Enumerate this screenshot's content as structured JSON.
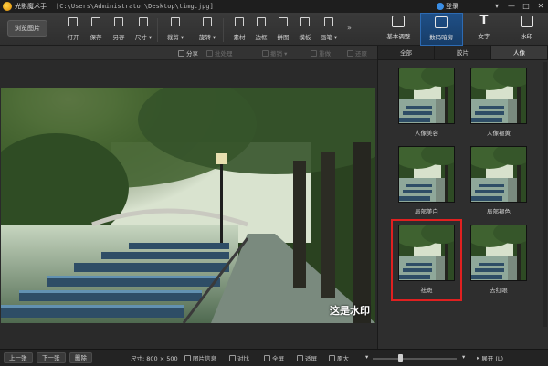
{
  "window": {
    "app_name": "光影魔术手",
    "file_path": "[C:\\Users\\Administrator\\Desktop\\timg.jpg]",
    "login_label": "登录",
    "controls": [
      "▾",
      "—",
      "□",
      "✕"
    ]
  },
  "toolbar": {
    "browse_label": "浏览图片",
    "tools": [
      {
        "label": "打开",
        "icon": "open-icon"
      },
      {
        "label": "保存",
        "icon": "save-icon"
      },
      {
        "label": "另存",
        "icon": "save-as-icon"
      },
      {
        "label": "尺寸 ▾",
        "icon": "resize-icon"
      },
      {
        "label": "裁剪 ▾",
        "icon": "crop-icon"
      },
      {
        "label": "旋转 ▾",
        "icon": "rotate-icon"
      },
      {
        "label": "素材",
        "icon": "material-icon"
      },
      {
        "label": "边框",
        "icon": "border-icon"
      },
      {
        "label": "拼图",
        "icon": "collage-icon"
      },
      {
        "label": "模板",
        "icon": "template-icon"
      },
      {
        "label": "画笔 ▾",
        "icon": "brush-icon"
      }
    ],
    "more": "»"
  },
  "right_tabs": [
    {
      "label": "基本调整",
      "icon": "adjust-icon",
      "active": false
    },
    {
      "label": "数码暗房",
      "icon": "camera-icon",
      "active": true
    },
    {
      "label": "文字",
      "icon": "text-icon",
      "active": false
    },
    {
      "label": "水印",
      "icon": "watermark-icon",
      "active": false
    }
  ],
  "subbar": {
    "items": [
      {
        "label": "分享",
        "icon": "share-icon",
        "enabled": true
      },
      {
        "label": "批处理",
        "icon": "batch-icon",
        "enabled": false
      },
      {
        "label": "撤销 ▾",
        "icon": "undo-icon",
        "enabled": false
      },
      {
        "label": "重做",
        "icon": "redo-icon",
        "enabled": false
      },
      {
        "label": "还原",
        "icon": "restore-icon",
        "enabled": false
      }
    ]
  },
  "canvas": {
    "watermark_text": "这是水印"
  },
  "panel": {
    "tabs": [
      {
        "label": "全部",
        "active": false
      },
      {
        "label": "胶片",
        "active": false
      },
      {
        "label": "人像",
        "active": true
      }
    ],
    "thumbnails": [
      {
        "label": "人像美容",
        "selected": false
      },
      {
        "label": "人像褪黄",
        "selected": false
      },
      {
        "label": "局部美白",
        "selected": false
      },
      {
        "label": "局部褪色",
        "selected": false
      },
      {
        "label": "祛斑",
        "selected": true
      },
      {
        "label": "去红眼",
        "selected": false
      }
    ]
  },
  "status": {
    "prev_label": "上一张",
    "next_label": "下一张",
    "delete_label": "删除",
    "size_text": "尺寸: 800 × 500",
    "items": [
      {
        "label": "图片信息",
        "icon": "info-icon"
      },
      {
        "label": "对比",
        "icon": "compare-icon"
      },
      {
        "label": "全屏",
        "icon": "fullscreen-icon"
      },
      {
        "label": "适屏",
        "icon": "fit-icon"
      },
      {
        "label": "原大",
        "icon": "actual-size-icon"
      }
    ],
    "zoom_minus": "▾",
    "zoom_plus": "▾",
    "zoom_level": 0.3,
    "expand_label": "展开 (L)"
  },
  "colors": {
    "accent_active_tab": "#1f4f86",
    "selection_outline": "#e02020"
  }
}
